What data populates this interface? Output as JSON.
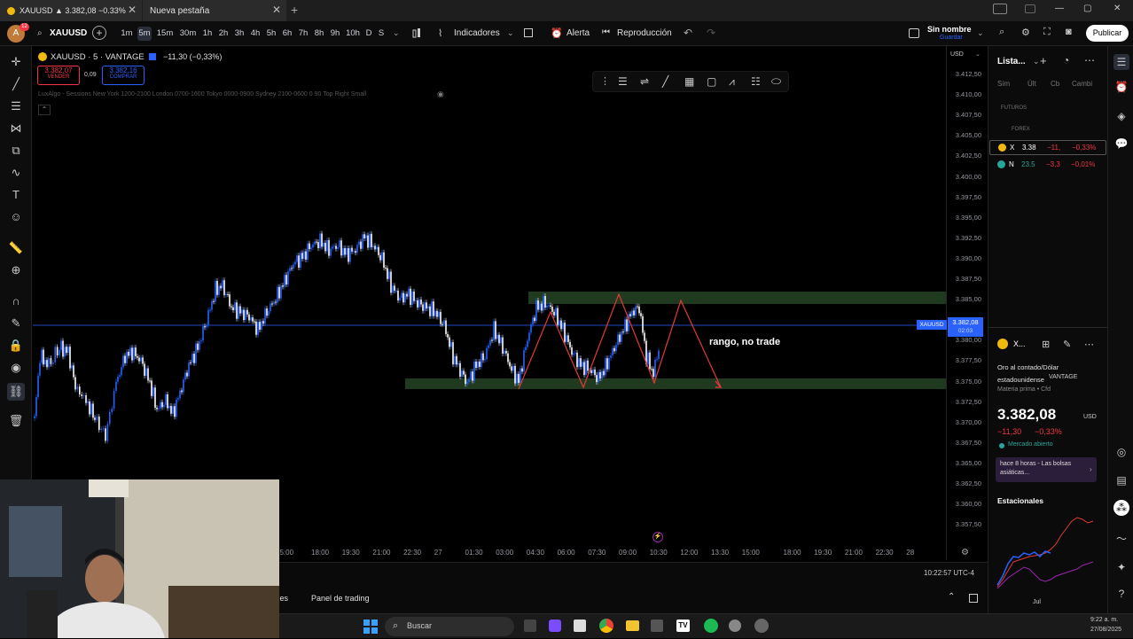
{
  "tabs": [
    {
      "label": "XAUUSD ▲ 3.382,08 −0.33%",
      "close": "✕"
    },
    {
      "label": "Nueva pestaña",
      "close": "✕"
    }
  ],
  "new_tab": "+",
  "window_controls": {
    "minimize": "—",
    "maximize": "▢",
    "close": "✕"
  },
  "toolbar": {
    "avatar_badge": "12",
    "symbol": "XAUUSD",
    "add": "+",
    "timeframes": [
      "1m",
      "5m",
      "15m",
      "30m",
      "1h",
      "2h",
      "3h",
      "4h",
      "5h",
      "6h",
      "7h",
      "8h",
      "9h",
      "10h",
      "D",
      "S"
    ],
    "selected_timeframe": "5m",
    "indicators": "Indicadores",
    "alert": "Alerta",
    "replay": "Reproducción",
    "layout_name": "Sin nombre",
    "layout_sub": "Guardar",
    "publish": "Publicar"
  },
  "legend": {
    "title": "XAUUSD · 5 · VANTAGE",
    "change": "−11,30 (−0,33%)",
    "sell_price": "3.382,07",
    "sell_label": "VENDER",
    "spread": "0,09",
    "buy_price": "3.382,16",
    "buy_label": "COMPRAR",
    "indicator_line": "LuxAlgo - Sessions New York 1200-2100 London 0700-1600 Tokyo 0000-0900 Sydney 2100-0600 0 90 Top Right Small"
  },
  "annotation": "rango, no trade",
  "price_scale": {
    "currency": "USD",
    "labels": [
      "3.412,50",
      "3.410,00",
      "3.407,50",
      "3.405,00",
      "3.402,50",
      "3.400,00",
      "3.397,50",
      "3.395,00",
      "3.392,50",
      "3.390,00",
      "3.387,50",
      "3.385,00",
      "3.382,50",
      "3.380,00",
      "3.377,50",
      "3.375,00",
      "3.372,50",
      "3.370,00",
      "3.367,50",
      "3.365,00",
      "3.362,50",
      "3.360,00",
      "3.357,50"
    ],
    "current_symbol": "XAUUSD",
    "current_price": "3.382,08",
    "countdown": "02:03"
  },
  "time_axis": [
    "15:00",
    "18:00",
    "19:30",
    "21:00",
    "22:30",
    "27",
    "01:30",
    "03:00",
    "04:30",
    "06:00",
    "07:30",
    "09:00",
    "10:30",
    "12:00",
    "13:30",
    "15:00",
    "18:00",
    "19:30",
    "21:00",
    "22:30",
    "28"
  ],
  "clock": "10:22:57 UTC-4",
  "bottom_tabs": [
    "Screener de acciones",
    "Panel de trading"
  ],
  "watchlist": {
    "title": "Lista...",
    "columns": [
      "Sím",
      "Últ",
      "Cb",
      "Cambi"
    ],
    "sections": [
      "FUTUROS",
      "FOREX"
    ],
    "rows": [
      {
        "sym": "X",
        "last": "3.38",
        "chg": "−11,",
        "pct": "−0,33%"
      },
      {
        "sym": "N",
        "last": "23.5",
        "chg": "−3,3",
        "pct": "−0,01%"
      }
    ]
  },
  "details": {
    "sym": "X...",
    "name": "Oro al contado/Dólar estadounidense",
    "broker": "VANTAGE",
    "category": "Materia prima • Cfd",
    "price": "3.382,08",
    "currency": "USD",
    "change": "−11,30",
    "pct": "−0,33%",
    "status": "Mercado abierto",
    "news": "hace 8 horas - Las bolsas asiáticas...",
    "seasonal_title": "Estacionales",
    "seasonal_month": "Jul"
  },
  "taskbar": {
    "search": "Buscar",
    "time": "9:22 a. m.",
    "date": "27/08/2025"
  },
  "colors": {
    "bull": "#2962ff",
    "bear": "#ffffff",
    "zone": "#1f3a1f",
    "path": "#e53935",
    "down": "#f23645"
  }
}
